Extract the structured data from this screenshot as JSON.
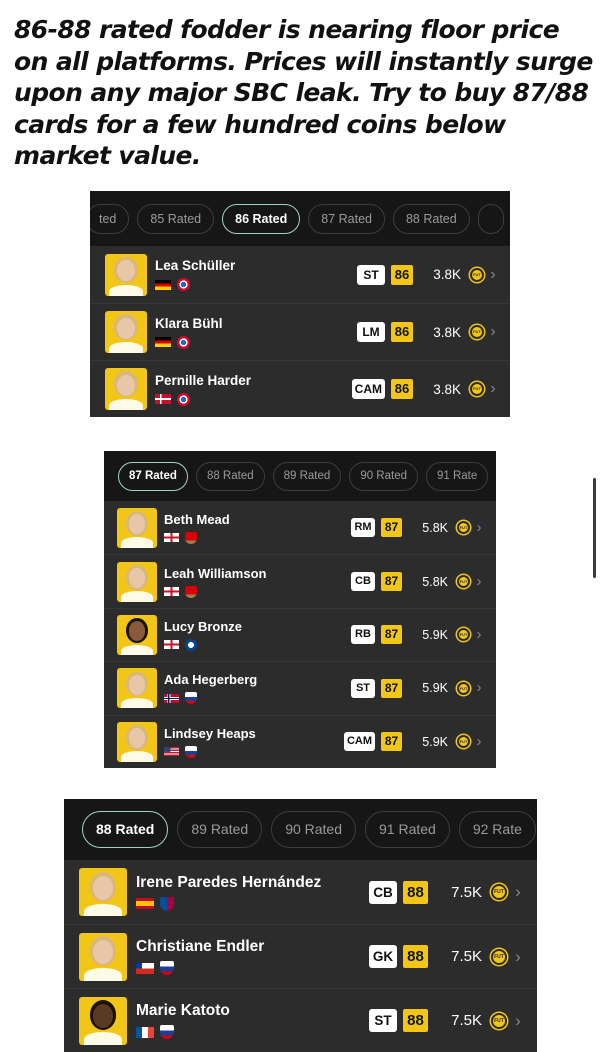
{
  "headline": "86-88 rated fodder is nearing floor price on all platforms. Prices will instantly surge upon any major SBC leak. Try to buy 87/88 cards for a few hundred coins below market value.",
  "coin_label": "FUT",
  "chevron": "›",
  "panels": [
    {
      "tabs": [
        {
          "label": "ted",
          "active": false
        },
        {
          "label": "85 Rated",
          "active": false
        },
        {
          "label": "86 Rated",
          "active": true
        },
        {
          "label": "87 Rated",
          "active": false
        },
        {
          "label": "88 Rated",
          "active": false
        },
        {
          "label": "",
          "active": false
        }
      ],
      "players": [
        {
          "name": "Lea Schüller",
          "position": "ST",
          "rating": "86",
          "price": "3.8K",
          "nation_flag": "germany-flag",
          "club_badge": "bayern-badge"
        },
        {
          "name": "Klara Bühl",
          "position": "LM",
          "rating": "86",
          "price": "3.8K",
          "nation_flag": "germany-flag",
          "club_badge": "bayern-badge"
        },
        {
          "name": "Pernille Harder",
          "position": "CAM",
          "rating": "86",
          "price": "3.8K",
          "nation_flag": "denmark-flag",
          "club_badge": "bayern-badge"
        }
      ]
    },
    {
      "tabs": [
        {
          "label": "87 Rated",
          "active": true
        },
        {
          "label": "88 Rated",
          "active": false
        },
        {
          "label": "89 Rated",
          "active": false
        },
        {
          "label": "90 Rated",
          "active": false
        },
        {
          "label": "91 Rate",
          "active": false
        }
      ],
      "players": [
        {
          "name": "Beth Mead",
          "position": "RM",
          "rating": "87",
          "price": "5.8K",
          "nation_flag": "england-flag",
          "club_badge": "arsenal-badge"
        },
        {
          "name": "Leah Williamson",
          "position": "CB",
          "rating": "87",
          "price": "5.8K",
          "nation_flag": "england-flag",
          "club_badge": "arsenal-badge"
        },
        {
          "name": "Lucy Bronze",
          "position": "RB",
          "rating": "87",
          "price": "5.9K",
          "nation_flag": "england-flag",
          "club_badge": "chelsea-badge"
        },
        {
          "name": "Ada Hegerberg",
          "position": "ST",
          "rating": "87",
          "price": "5.9K",
          "nation_flag": "norway-flag",
          "club_badge": "lyon-badge"
        },
        {
          "name": "Lindsey Heaps",
          "position": "CAM",
          "rating": "87",
          "price": "5.9K",
          "nation_flag": "usa-flag",
          "club_badge": "lyon-badge"
        }
      ]
    },
    {
      "tabs": [
        {
          "label": "88 Rated",
          "active": true
        },
        {
          "label": "89 Rated",
          "active": false
        },
        {
          "label": "90 Rated",
          "active": false
        },
        {
          "label": "91 Rated",
          "active": false
        },
        {
          "label": "92 Rate",
          "active": false
        }
      ],
      "players": [
        {
          "name": "Irene Paredes Hernández",
          "position": "CB",
          "rating": "88",
          "price": "7.5K",
          "nation_flag": "spain-flag",
          "club_badge": "barcelona-badge"
        },
        {
          "name": "Christiane Endler",
          "position": "GK",
          "rating": "88",
          "price": "7.5K",
          "nation_flag": "chile-flag",
          "club_badge": "lyon-badge"
        },
        {
          "name": "Marie Katoto",
          "position": "ST",
          "rating": "88",
          "price": "7.5K",
          "nation_flag": "france-flag",
          "club_badge": "lyon-badge"
        }
      ]
    }
  ]
}
